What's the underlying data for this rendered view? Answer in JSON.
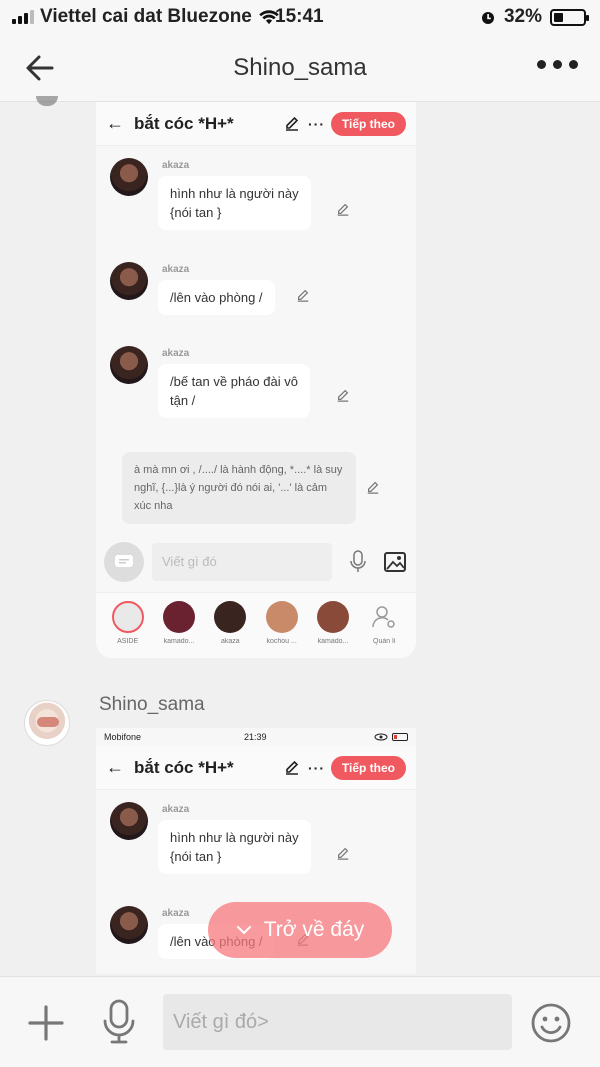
{
  "status_bar": {
    "carrier": "Viettel cai dat Bluezone",
    "time": "15:41",
    "battery": "32%",
    "battery_level": 0.32
  },
  "header": {
    "title": "Shino_sama",
    "back_icon": "arrow-left-icon",
    "more_icon": "more-horizontal-icon"
  },
  "screenshot_1": {
    "bar": {
      "back": "←",
      "title": "bắt cóc *H+*",
      "dots": "···",
      "next_button": "Tiếp theo"
    },
    "messages": [
      {
        "name": "akaza",
        "lines": [
          "hình như là người này",
          "{nói tan }"
        ]
      },
      {
        "name": "akaza",
        "lines": [
          "/lên vào phòng /"
        ]
      },
      {
        "name": "akaza",
        "lines": [
          "/bế tan về pháo đài vô",
          "tận /"
        ]
      }
    ],
    "note": "à mà mn ơi , /..../ là hành động, *....* là suy nghĩ, {...}là ý người đó nói ai, '...' là cảm xúc nha",
    "input_placeholder": "Viết gì đó",
    "characters": [
      {
        "label": "ASIDE",
        "color": "#e9e9e9"
      },
      {
        "label": "kamado...",
        "color": "#6b2230"
      },
      {
        "label": "akaza",
        "color": "#3a2420"
      },
      {
        "label": "kochou ...",
        "color": "#c98a6a"
      },
      {
        "label": "kamado...",
        "color": "#8a4a3a"
      },
      {
        "label": "Quản lí",
        "color": "#fafafa"
      }
    ]
  },
  "sender_name": "Shino_sama",
  "screenshot_2": {
    "status": {
      "carrier": "Mobifone",
      "time": "21:39"
    },
    "bar": {
      "back": "←",
      "title": "bắt cóc *H+*",
      "dots": "···",
      "next_button": "Tiếp theo"
    },
    "messages": [
      {
        "name": "akaza",
        "lines": [
          "hình như là người này",
          "{nói tan }"
        ]
      },
      {
        "name": "akaza",
        "lines": [
          "/lên vào phòng /"
        ]
      }
    ]
  },
  "back_to_bottom": "Trở về đáy",
  "composer": {
    "placeholder": "Viết gì đó>",
    "plus_icon": "plus-icon",
    "mic_icon": "microphone-icon",
    "emoji_icon": "emoji-icon"
  }
}
